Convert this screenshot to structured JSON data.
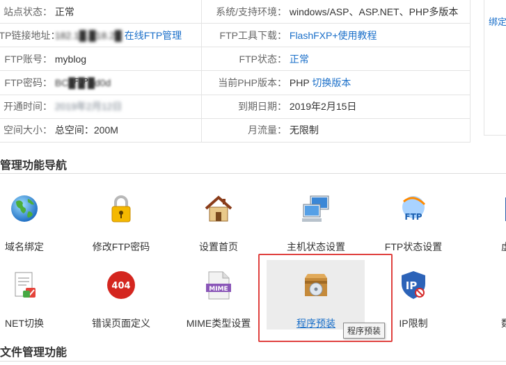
{
  "info": {
    "rows": [
      {
        "l_label": "站点状态：",
        "l_value": "正常",
        "r_label": "系统/支持环境：",
        "r_value": "windows/ASP、ASP.NET、PHP多版本"
      },
      {
        "l_label": "FTP链接地址：",
        "l_value": "182.1█.█18.2█",
        "l_link": "在线FTP管理",
        "r_label": "FTP工具下载：",
        "r_link": "FlashFXP+使用教程"
      },
      {
        "l_label": "FTP账号：",
        "l_value": "myblog",
        "r_label": "FTP状态：",
        "r_link": "正常"
      },
      {
        "l_label": "FTP密码：",
        "l_value": "BC█ █ █d0d",
        "r_label": "当前PHP版本：",
        "r_value": "PHP",
        "r_link": "切换版本"
      },
      {
        "l_label": "开通时间：",
        "l_value": "2019年2月12日",
        "r_label": "到期日期：",
        "r_value": "2019年2月15日"
      },
      {
        "l_label": "空间大小：",
        "l_value": "总空间：200M",
        "r_label": "月流量：",
        "r_value": "无限制"
      }
    ],
    "pw_overlay": "FTP:"
  },
  "side": {
    "link": "绑定"
  },
  "section1_title": "管理功能导航",
  "section2_title": "文件管理功能",
  "tools": [
    {
      "label": "域名绑定",
      "icon": "globe-icon"
    },
    {
      "label": "修改FTP密码",
      "icon": "padlock-icon"
    },
    {
      "label": "设置首页",
      "icon": "house-icon"
    },
    {
      "label": "主机状态设置",
      "icon": "computer-icon"
    },
    {
      "label": "FTP状态设置",
      "icon": "ftp-globe-icon"
    },
    {
      "label": "虚拟",
      "icon": "book-icon"
    },
    {
      "label": "NET切换",
      "icon": "document-icon"
    },
    {
      "label": "错误页面定义",
      "icon": "error-404-icon"
    },
    {
      "label": "MIME类型设置",
      "icon": "mime-file-icon"
    },
    {
      "label": "程序预装",
      "icon": "package-disc-icon"
    },
    {
      "label": "IP限制",
      "icon": "ip-shield-icon"
    },
    {
      "label": "数据",
      "icon": "database-icon"
    }
  ],
  "tooltip": "程序预装",
  "colors": {
    "link": "#1a6fc9",
    "highlight": "#e0413f",
    "border": "#e3e3e3"
  }
}
